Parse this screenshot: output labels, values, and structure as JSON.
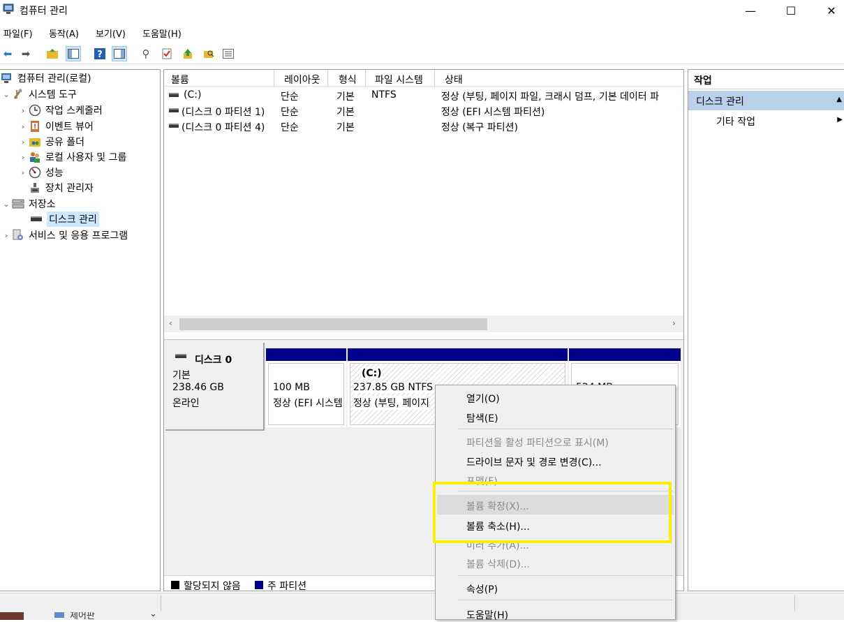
{
  "window": {
    "title": "컴퓨터 관리",
    "minimize": "—",
    "maximize": "☐",
    "close": "✕"
  },
  "menu": [
    "파일(F)",
    "동작(A)",
    "보기(V)",
    "도움말(H)"
  ],
  "tree": {
    "root": "컴퓨터 관리(로컬)",
    "system_tools": "시스템 도구",
    "task_scheduler": "작업 스케줄러",
    "event_viewer": "이벤트 뷰어",
    "shared_folders": "공유 폴더",
    "local_users": "로컬 사용자 및 그룹",
    "performance": "성능",
    "device_manager": "장치 관리자",
    "storage": "저장소",
    "disk_management": "디스크 관리",
    "services_apps": "서비스 및 응용 프로그램"
  },
  "list": {
    "columns": [
      "볼륨",
      "레이아웃",
      "형식",
      "파일 시스템",
      "상태"
    ],
    "rows": [
      {
        "volume": "(C:)",
        "layout": "단순",
        "type": "기본",
        "fs": "NTFS",
        "status": "정상 (부팅, 페이지 파일, 크래시 덤프, 기본 데이터 파"
      },
      {
        "volume": "(디스크 0 파티션 1)",
        "layout": "단순",
        "type": "기본",
        "fs": "",
        "status": "정상 (EFI 시스템 파티션)"
      },
      {
        "volume": "(디스크 0 파티션 4)",
        "layout": "단순",
        "type": "기본",
        "fs": "",
        "status": "정상 (복구 파티션)"
      }
    ]
  },
  "disk": {
    "name": "디스크 0",
    "type": "기본",
    "size": "238.46 GB",
    "status": "온라인",
    "partitions": [
      {
        "title": "",
        "size": "100 MB",
        "status": "정상 (EFI 시스템"
      },
      {
        "title": "(C:)",
        "size": "237.85 GB NTFS",
        "status": "정상 (부팅, 페이지"
      },
      {
        "title": "",
        "size": "524 MB",
        "status": ""
      }
    ]
  },
  "legend": {
    "unallocated": "할당되지 않음",
    "primary": "주 파티션",
    "unallocated_color": "#000000",
    "primary_color": "#00008b"
  },
  "actions": {
    "header": "작업",
    "section": "디스크 관리",
    "more": "기타 작업"
  },
  "context_menu": {
    "open": "열기(O)",
    "explore": "탐색(E)",
    "mark_active": "파티션을 활성 파티션으로 표시(M)",
    "change_letter": "드라이브 문자 및 경로 변경(C)...",
    "format": "포맷(F)...",
    "extend": "볼륨 확장(X)...",
    "shrink": "볼륨 축소(H)...",
    "add_mirror": "미러 추가(A)...",
    "delete": "볼륨 삭제(D)...",
    "properties": "속성(P)",
    "help": "도움말(H)"
  },
  "taskbar": {
    "label": "제어판"
  },
  "colors": {
    "highlight": "#ffee00",
    "action_section": "#b9d1ea",
    "partition_bar": "#00008b"
  }
}
